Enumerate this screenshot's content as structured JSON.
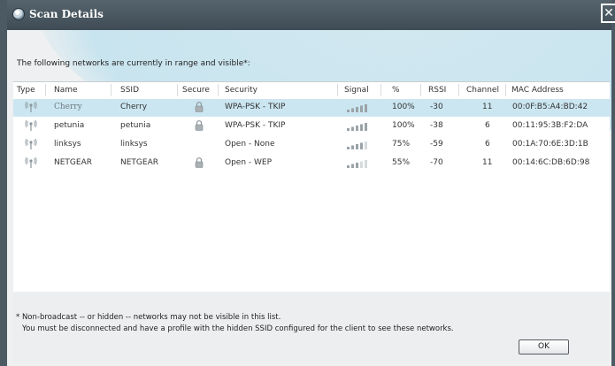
{
  "window": {
    "title": "Scan Details",
    "close_glyph": "✕"
  },
  "intro_text": "The following networks are currently in range and visible*:",
  "columns": [
    "Type",
    "Name",
    "SSID",
    "Secure",
    "Security",
    "Signal",
    "%",
    "RSSI",
    "Channel",
    "MAC Address"
  ],
  "networks": [
    {
      "name": "Cherry",
      "ssid": "Cherry",
      "secure": true,
      "security": "WPA-PSK - TKIP",
      "signal_level": 1.0,
      "percent": "100%",
      "rssi": "-30",
      "channel": "11",
      "mac": "00:0F:B5:A4:BD:42",
      "selected": true
    },
    {
      "name": "petunia",
      "ssid": "petunia",
      "secure": true,
      "security": "WPA-PSK - TKIP",
      "signal_level": 1.0,
      "percent": "100%",
      "rssi": "-38",
      "channel": "6",
      "mac": "00:11:95:3B:F2:DA",
      "selected": false
    },
    {
      "name": "linksys",
      "ssid": "linksys",
      "secure": false,
      "security": "Open - None",
      "signal_level": 0.75,
      "percent": "75%",
      "rssi": "-59",
      "channel": "6",
      "mac": "00:1A:70:6E:3D:1B",
      "selected": false
    },
    {
      "name": "NETGEAR",
      "ssid": "NETGEAR",
      "secure": true,
      "security": "Open - WEP",
      "signal_level": 0.55,
      "percent": "55%",
      "rssi": "-70",
      "channel": "11",
      "mac": "00:14:6C:DB:6D:98",
      "selected": false
    }
  ],
  "footer": {
    "note_line1": "* Non-broadcast -- or hidden -- networks may not be visible in this list.",
    "note_line2": "You must be disconnected and have a profile with the hidden SSID configured for the client to see these networks.",
    "ok_label": "OK"
  },
  "colors": {
    "titlebar": "#4c5a63",
    "selected_row": "#cbe6f1",
    "accent_swoosh": "#c4e3ee"
  },
  "icons": {
    "type": "wifi-antenna-icon",
    "secure": "lock-icon",
    "signal": "signal-bars-icon",
    "window": "app-globe-icon"
  }
}
